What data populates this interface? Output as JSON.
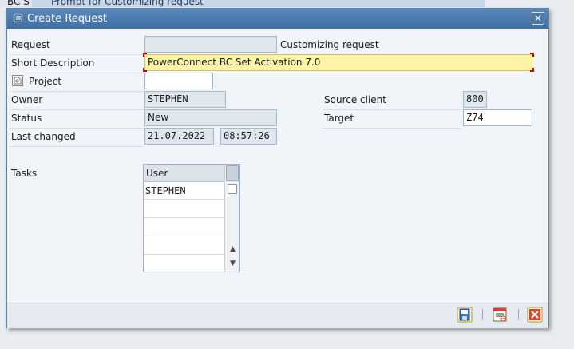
{
  "background": {
    "left_title": "BC S",
    "prompt_title": "Prompt for Customizing request"
  },
  "dialog": {
    "title": "Create Request",
    "title_icon": "create-request-icon",
    "close_icon": "close-icon"
  },
  "form": {
    "request_label": "Request",
    "request_value": "",
    "request_type": "Customizing request",
    "short_desc_label": "Short Description",
    "short_desc_value": "PowerConnect BC Set Activation 7.0",
    "project_label": "Project",
    "project_value": "",
    "owner_label": "Owner",
    "owner_value": "STEPHEN",
    "status_label": "Status",
    "status_value": "New",
    "last_changed_label": "Last changed",
    "last_changed_date": "21.07.2022",
    "last_changed_time": "08:57:26",
    "source_client_label": "Source client",
    "source_client_value": "800",
    "target_label": "Target",
    "target_value": "Z74"
  },
  "tasks": {
    "label": "Tasks",
    "column_header": "User",
    "rows": [
      "STEPHEN",
      "",
      "",
      "",
      ""
    ]
  },
  "footer": {
    "save_icon": "save-icon",
    "other_icon": "list-options-icon",
    "cancel_icon": "cancel-icon"
  },
  "colors": {
    "title_bar": "#4a79ad",
    "active_field": "#fbf3a6",
    "cancel": "#c0392b"
  }
}
